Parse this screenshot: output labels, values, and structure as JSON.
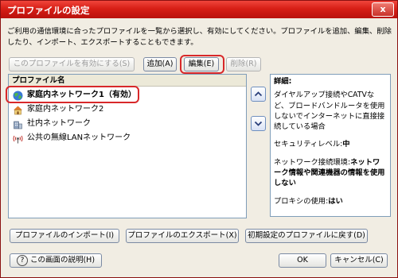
{
  "window": {
    "title": "プロファイルの設定",
    "close_glyph": "x"
  },
  "description": "ご利用の通信環境に合ったプロファイルを一覧から選択し、有効にしてください。プロファイルを追加、編集、削除したり、インポート、エクスポートすることもできます。",
  "toolbar": {
    "activate": "このプロファイルを有効にする(S)",
    "add": "追加(A)",
    "edit": "編集(E)",
    "delete": "削除(R)"
  },
  "list": {
    "header": "プロファイル名",
    "items": [
      {
        "label": "家庭内ネットワーク1（有効）",
        "icon": "globe-icon",
        "selected": true
      },
      {
        "label": "家庭内ネットワーク2",
        "icon": "house-icon",
        "selected": false
      },
      {
        "label": "社内ネットワーク",
        "icon": "building-icon",
        "selected": false
      },
      {
        "label": "公共の無線LANネットワーク",
        "icon": "wireless-icon",
        "selected": false
      }
    ]
  },
  "details": {
    "heading": "詳細:",
    "connection_desc": "ダイヤルアップ接続やCATVなど、ブロードバンドルータを使用しないでインターネットに直接接続している場合",
    "security_label": "セキュリティレベル:",
    "security_value": "中",
    "network_label": "ネットワーク接続環境:",
    "network_value": "ネットワーク情報や関連機器の情報を使用しない",
    "proxy_label": "プロキシの使用:",
    "proxy_value": "はい"
  },
  "bottom": {
    "import": "プロファイルのインポート(I)",
    "export": "プロファイルのエクスポート(X)",
    "restore": "初期設定のプロファイルに戻す(D)",
    "help": "この画面の説明(H)",
    "ok": "OK",
    "cancel": "キャンセル(C)"
  },
  "colors": {
    "titlebar": "#d71f16",
    "highlight_ring": "#d8282a",
    "window_bg": "#f1ede3"
  }
}
